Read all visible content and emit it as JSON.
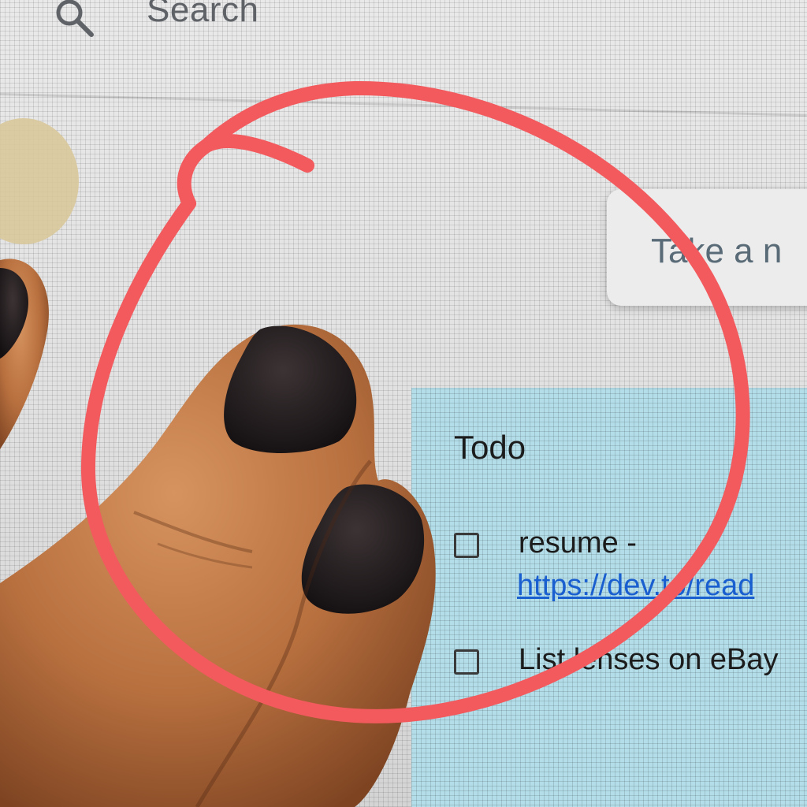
{
  "search": {
    "placeholder": "Search",
    "icon": "search-icon"
  },
  "take_note": {
    "placeholder": "Take a n"
  },
  "note": {
    "title": "Todo",
    "items": [
      {
        "text": "resume -",
        "link": "https://dev.to/read",
        "checked": false
      },
      {
        "text": "List lenses on eBay",
        "checked": false
      }
    ],
    "color": "#b3dde8"
  },
  "annotation": {
    "color": "#f25a5e",
    "shape": "hand-drawn-circle"
  },
  "avatar": {
    "color": "#d9c89a"
  }
}
